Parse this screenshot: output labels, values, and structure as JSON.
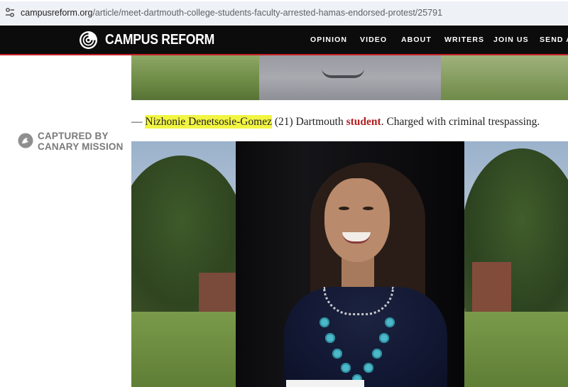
{
  "browser": {
    "url_host": "campusreform.org",
    "url_path": "/article/meet-dartmouth-college-students-faculty-arrested-hamas-endorsed-protest/25791",
    "site_icon": "tune-icon"
  },
  "site": {
    "logo_text": "CAMPUS REFORM",
    "logo_icon": "campus-reform-logo-icon",
    "accent_color": "#c62026",
    "nav": [
      "OPINION",
      "VIDEO",
      "ABOUT",
      "WRITERS",
      "JOIN US",
      "SEND A"
    ]
  },
  "article": {
    "caption": {
      "dash": "— ",
      "name": "Nizhonie Denetsosie-Gomez",
      "age": " (21) Dartmouth ",
      "keyword": "student",
      "rest": ". Charged with criminal trespassing.",
      "highlight_color": "#f2f542",
      "keyword_color": "#b41f1f"
    },
    "watermark": {
      "line1": "CAPTURED BY",
      "line2": "CANARY MISSION",
      "icon": "canary-mission-icon"
    }
  }
}
